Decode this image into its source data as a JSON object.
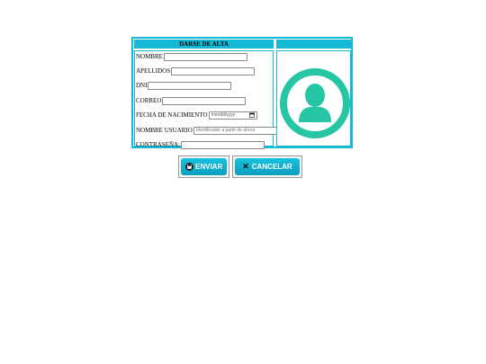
{
  "form": {
    "header_title": "DARSE DE ALTA",
    "fields": {
      "nombre": {
        "label": "NOMBRE",
        "value": "",
        "placeholder": ""
      },
      "apellidos": {
        "label": "APELLIDOS",
        "value": "",
        "placeholder": ""
      },
      "dni": {
        "label": "DNI",
        "value": "",
        "placeholder": ""
      },
      "correo": {
        "label": "CORREO",
        "value": "",
        "placeholder": ""
      },
      "fecha": {
        "label": "FECHA DE NACIMIENTO",
        "value": "mm/dd/yyyy"
      },
      "usuario": {
        "label": "NOMBRE USUARIO",
        "value": "",
        "placeholder": "Identificador a partir de ahora"
      },
      "contrasena": {
        "label": "CONTRASEÑA:",
        "value": "",
        "placeholder": ""
      }
    },
    "avatar_icon": "user-avatar-icon"
  },
  "buttons": {
    "submit_label": "ENVIAR",
    "submit_icon": "save-icon",
    "cancel_label": "CANCELAR",
    "cancel_icon": "close-icon"
  },
  "colors": {
    "accent": "#15b9d6",
    "avatar": "#26c6a4"
  }
}
